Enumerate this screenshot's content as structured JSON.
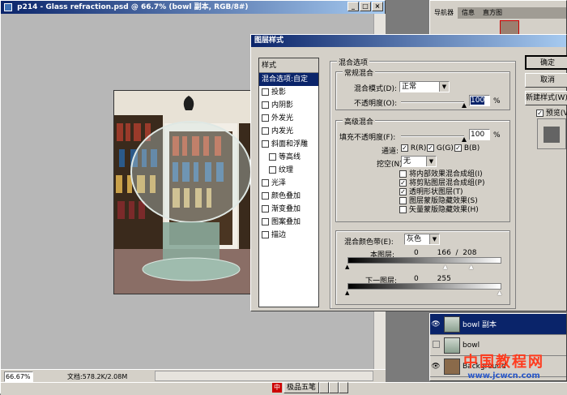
{
  "document_window": {
    "title": "p214 - Glass refraction.psd @ 66.7% (bowl 副本, RGB/8#)",
    "zoom": "66.67%",
    "doc_info": "文档:578.2K/2.08M"
  },
  "panels": {
    "tabs": [
      "导航器",
      "信息",
      "直方图"
    ],
    "layers": [
      {
        "name": "bowl 副本",
        "selected": true
      },
      {
        "name": "bowl",
        "selected": false
      },
      {
        "name": "Background",
        "selected": false
      }
    ]
  },
  "taskbar": {
    "ime_label": "极品五笔"
  },
  "watermark": {
    "text": "中国教程网",
    "url": "www.jcwcn.com"
  },
  "dialog": {
    "title": "图层样式",
    "styles_header": "样式",
    "styles": [
      {
        "label": "混合选项:自定",
        "checkbox": false,
        "selected": true
      },
      {
        "label": "投影",
        "checkbox": true
      },
      {
        "label": "内阴影",
        "checkbox": true
      },
      {
        "label": "外发光",
        "checkbox": true
      },
      {
        "label": "内发光",
        "checkbox": true
      },
      {
        "label": "斜面和浮雕",
        "checkbox": true
      },
      {
        "label": "等高线",
        "checkbox": true,
        "indent": true
      },
      {
        "label": "纹理",
        "checkbox": true,
        "indent": true
      },
      {
        "label": "光泽",
        "checkbox": true
      },
      {
        "label": "颜色叠加",
        "checkbox": true
      },
      {
        "label": "渐变叠加",
        "checkbox": true
      },
      {
        "label": "图案叠加",
        "checkbox": true
      },
      {
        "label": "描边",
        "checkbox": true
      }
    ],
    "blend_options_title": "混合选项",
    "general": {
      "title": "常规混合",
      "mode_label": "混合模式(D):",
      "mode_value": "正常",
      "opacity_label": "不透明度(O):",
      "opacity_value": "100",
      "percent": "%"
    },
    "advanced": {
      "title": "高级混合",
      "fill_label": "填充不透明度(F):",
      "fill_value": "100",
      "percent": "%",
      "channels_label": "通道:",
      "channels": [
        "R(R)",
        "G(G)",
        "B(B)"
      ],
      "knockout_label": "挖空(N):",
      "knockout_value": "无",
      "options": [
        {
          "label": "将内部效果混合成组(I)",
          "checked": false
        },
        {
          "label": "将剪贴图层混合成组(P)",
          "checked": true
        },
        {
          "label": "透明形状图层(T)",
          "checked": true
        },
        {
          "label": "图层蒙版隐藏效果(S)",
          "checked": false
        },
        {
          "label": "矢量蒙版隐藏效果(H)",
          "checked": false
        }
      ]
    },
    "blend_if": {
      "title": "混合颜色带(E):",
      "value": "灰色",
      "this_layer_label": "本图层:",
      "this_layer_values": "0        166  /  208",
      "below_layer_label": "下一图层:",
      "below_layer_values": "0        255"
    },
    "buttons": {
      "ok": "确定",
      "cancel": "取消",
      "new_style": "新建样式(W)...",
      "preview": "预览(V)"
    }
  }
}
